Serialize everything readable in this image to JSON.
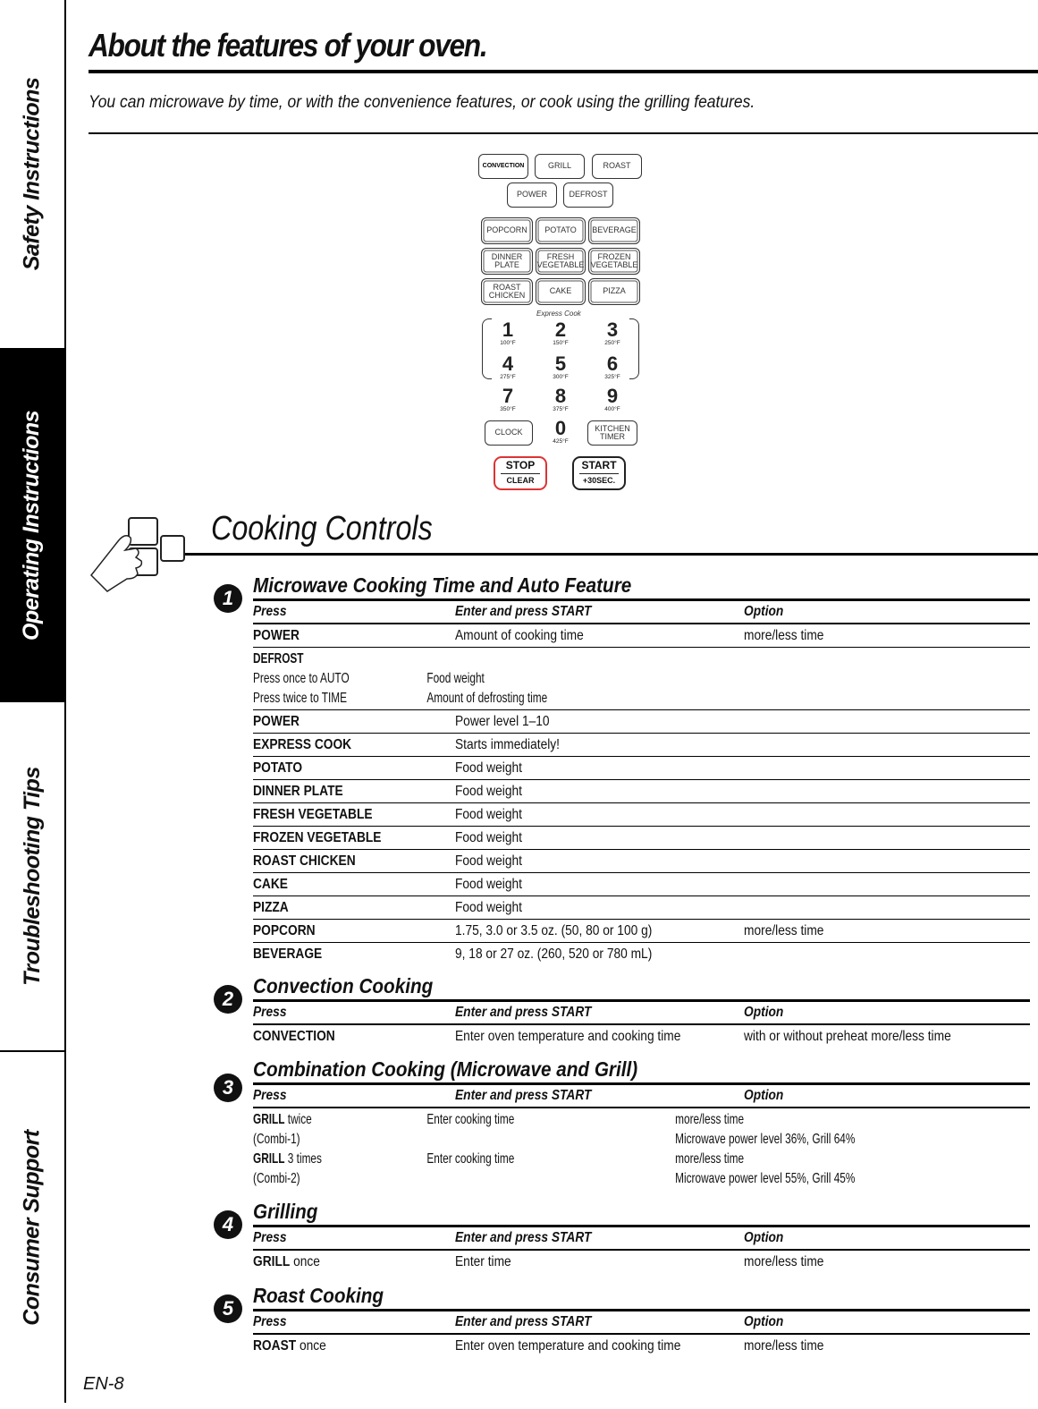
{
  "side_tabs": [
    {
      "label": "Safety Instructions",
      "active": false
    },
    {
      "label": "Operating Instructions",
      "active": true
    },
    {
      "label": "Troubleshooting Tips",
      "active": false
    },
    {
      "label": "Consumer Support",
      "active": false
    }
  ],
  "header": {
    "title": "About the features of your oven.",
    "subtitle": "You can microwave by time, or with the convenience features, or cook using the grilling features."
  },
  "keypad": {
    "row1": [
      "CONVECTION",
      "GRILL",
      "ROAST"
    ],
    "row2": [
      "POWER",
      "DEFROST"
    ],
    "row3": [
      "POPCORN",
      "POTATO",
      "BEVERAGE"
    ],
    "row4": [
      "DINNER\nPLATE",
      "FRESH\nVEGETABLE",
      "FROZEN\nVEGETABLE"
    ],
    "row5": [
      "ROAST\nCHICKEN",
      "CAKE",
      "PIZZA"
    ],
    "express_label": "Express Cook",
    "numbers": [
      {
        "digit": "1",
        "temp": "100°F"
      },
      {
        "digit": "2",
        "temp": "150°F"
      },
      {
        "digit": "3",
        "temp": "250°F"
      },
      {
        "digit": "4",
        "temp": "275°F"
      },
      {
        "digit": "5",
        "temp": "300°F"
      },
      {
        "digit": "6",
        "temp": "325°F"
      },
      {
        "digit": "7",
        "temp": "350°F"
      },
      {
        "digit": "8",
        "temp": "375°F"
      },
      {
        "digit": "9",
        "temp": "400°F"
      },
      {
        "digit": "0",
        "temp": "425°F"
      }
    ],
    "clock": "CLOCK",
    "kitchen_timer": "KITCHEN\nTIMER",
    "stop": "STOP",
    "clear": "CLEAR",
    "start": "START",
    "plus30": "+30SEC."
  },
  "cooking_controls": {
    "title": "Cooking Controls",
    "columns": [
      "Press",
      "Enter and press START",
      "Option"
    ],
    "sections": [
      {
        "number": "1",
        "title": "Microwave Cooking Time and Auto Feature",
        "rows": [
          {
            "press": "POWER",
            "press_suffix": "",
            "enter": "Amount of cooking time",
            "option": "more/less time"
          },
          {
            "press": "DEFROST",
            "press_suffix": "",
            "enter": "",
            "option": "",
            "sub": [
              {
                "press": "Press once to AUTO",
                "enter": "Food weight"
              },
              {
                "press": "Press twice to TIME",
                "enter": "Amount of defrosting time"
              }
            ]
          },
          {
            "press": "POWER",
            "press_suffix": "",
            "enter": "Power level 1–10",
            "option": ""
          },
          {
            "press": "EXPRESS COOK",
            "press_suffix": "",
            "enter": "Starts immediately!",
            "option": ""
          },
          {
            "press": "POTATO",
            "press_suffix": "",
            "enter": "Food weight",
            "option": ""
          },
          {
            "press": "DINNER PLATE",
            "press_suffix": "",
            "enter": "Food weight",
            "option": ""
          },
          {
            "press": "FRESH VEGETABLE",
            "press_suffix": "",
            "enter": "Food weight",
            "option": ""
          },
          {
            "press": "FROZEN VEGETABLE",
            "press_suffix": "",
            "enter": "Food weight",
            "option": ""
          },
          {
            "press": "ROAST CHICKEN",
            "press_suffix": "",
            "enter": "Food weight",
            "option": ""
          },
          {
            "press": "CAKE",
            "press_suffix": "",
            "enter": "Food weight",
            "option": ""
          },
          {
            "press": "PIZZA",
            "press_suffix": "",
            "enter": "Food weight",
            "option": ""
          },
          {
            "press": "POPCORN",
            "press_suffix": "",
            "enter": "1.75, 3.0 or 3.5 oz. (50, 80 or 100 g)",
            "option": "more/less time"
          },
          {
            "press": "BEVERAGE",
            "press_suffix": "",
            "enter": "9, 18 or 27 oz. (260, 520 or 780 mL)",
            "option": ""
          }
        ]
      },
      {
        "number": "2",
        "title": "Convection Cooking",
        "rows": [
          {
            "press": "CONVECTION",
            "press_suffix": "",
            "enter": "Enter oven temperature and cooking time",
            "option": "with or without preheat more/less time"
          }
        ]
      },
      {
        "number": "3",
        "title": "Combination Cooking (Microwave and Grill)",
        "rows": [
          {
            "press": "GRILL",
            "press_suffix": " twice",
            "enter": "Enter cooking time",
            "option": "more/less time"
          },
          {
            "press": "",
            "press_suffix": "(Combi-1)",
            "enter": "",
            "option": "Microwave power level 36%, Grill 64%"
          },
          {
            "press": "GRILL",
            "press_suffix": " 3 times",
            "enter": "Enter cooking time",
            "option": "more/less time"
          },
          {
            "press": "",
            "press_suffix": "(Combi-2)",
            "enter": "",
            "option": "Microwave power level 55%, Grill 45%"
          }
        ]
      },
      {
        "number": "4",
        "title": "Grilling",
        "rows": [
          {
            "press": "GRILL",
            "press_suffix": " once",
            "enter": "Enter time",
            "option": "more/less time"
          }
        ]
      },
      {
        "number": "5",
        "title": "Roast Cooking",
        "rows": [
          {
            "press": "ROAST",
            "press_suffix": " once",
            "enter": "Enter oven temperature and cooking time",
            "option": "more/less time"
          }
        ]
      }
    ]
  },
  "footer": {
    "page_number": "EN-8"
  }
}
